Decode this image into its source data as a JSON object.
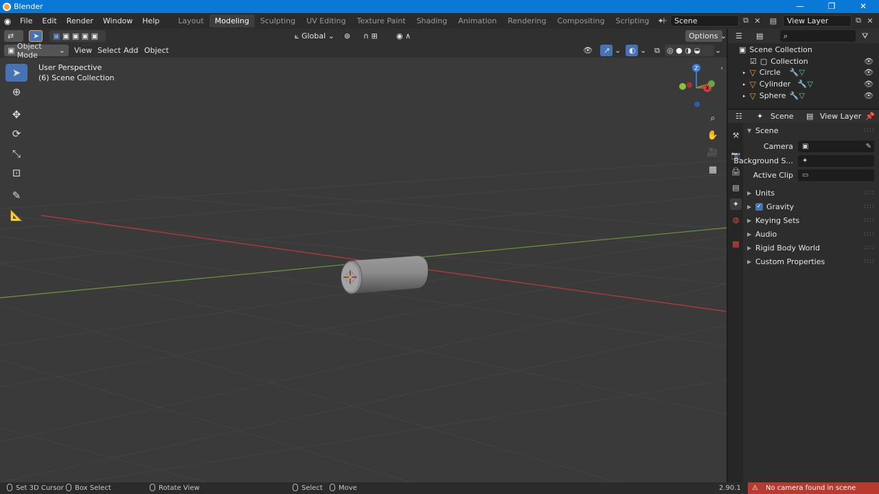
{
  "window": {
    "title": "Blender",
    "minimize": "—",
    "maximize": "❐",
    "close": "✕"
  },
  "menu": {
    "items": [
      "File",
      "Edit",
      "Render",
      "Window",
      "Help"
    ]
  },
  "workspaces": {
    "tabs": [
      "Layout",
      "Modeling",
      "Sculpting",
      "UV Editing",
      "Texture Paint",
      "Shading",
      "Animation",
      "Rendering",
      "Compositing",
      "Scripting"
    ],
    "active": "Modeling",
    "add": "+"
  },
  "scene_selector": {
    "scene": "Scene",
    "view_layer": "View Layer"
  },
  "viewport_header": {
    "mode": "Object Mode",
    "menus": [
      "View",
      "Select",
      "Add",
      "Object"
    ],
    "transform_orientation": "Global",
    "options": "Options"
  },
  "viewport": {
    "perspective_label": "User Perspective",
    "collection_label": "(6) Scene Collection",
    "gizmo": {
      "z": "Z",
      "x": "X"
    }
  },
  "outliner": {
    "root": "Scene Collection",
    "collection": "Collection",
    "objects": [
      "Circle",
      "Cylinder",
      "Sphere"
    ]
  },
  "properties": {
    "header_scene": "Scene",
    "header_view_layer": "View Layer",
    "panel_title": "Scene",
    "rows": [
      {
        "label": "Camera",
        "value": ""
      },
      {
        "label": "Background S...",
        "value": ""
      },
      {
        "label": "Active Clip",
        "value": ""
      }
    ],
    "sections": [
      "Units",
      "Gravity",
      "Keying Sets",
      "Audio",
      "Rigid Body World",
      "Custom Properties"
    ]
  },
  "statusbar": {
    "set_cursor": "Set 3D Cursor",
    "box_select": "Box Select",
    "rotate_view": "Rotate View",
    "select": "Select",
    "move": "Move",
    "version": "2.90.1",
    "warning": "No camera found in scene \"Scene\""
  },
  "colors": {
    "accent": "#4772b3",
    "title_bar": "#0a78d7",
    "warning": "#b83a2e",
    "axis_x": "#c0393b",
    "axis_y": "#6b9a35"
  }
}
